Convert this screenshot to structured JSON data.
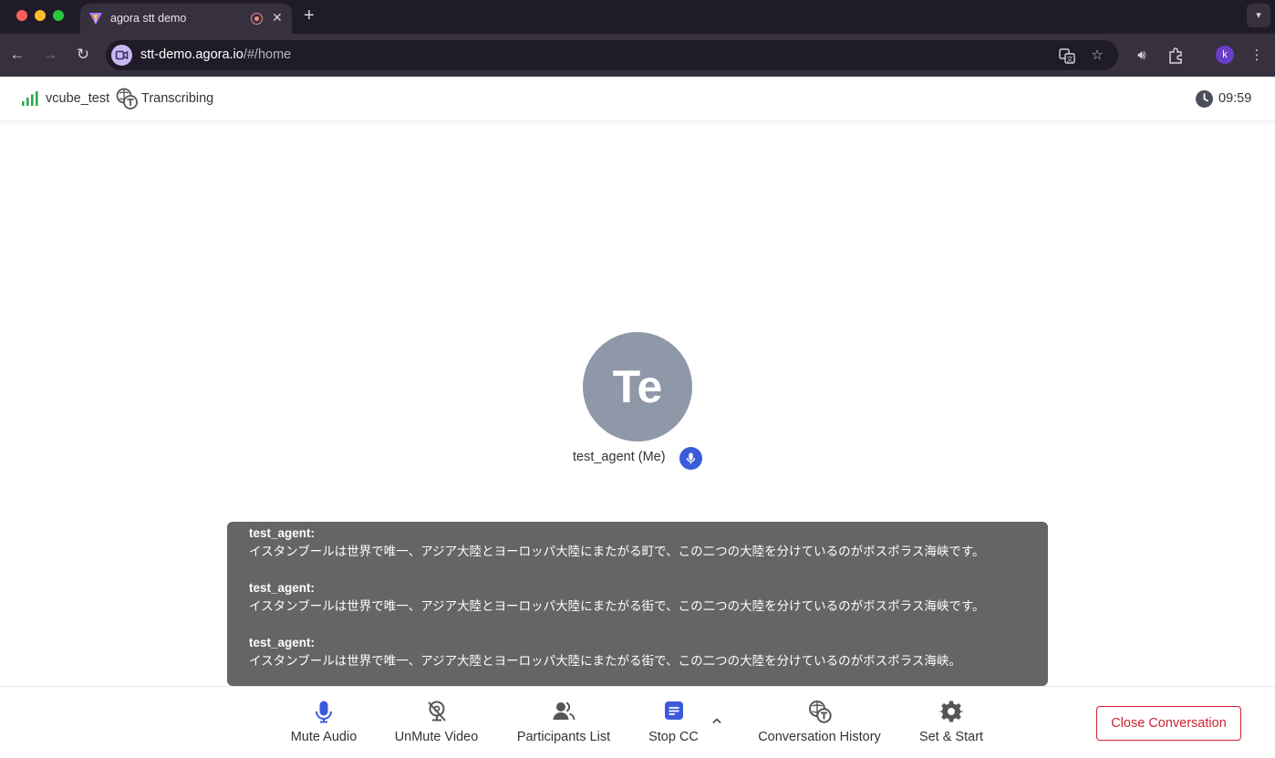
{
  "browser": {
    "tab_title": "agora stt demo",
    "url_host": "stt-demo.agora.io",
    "url_path": "/#/home",
    "profile_initial": "k"
  },
  "header": {
    "channel_name": "vcube_test",
    "status_label": "Transcribing",
    "timer": "09:59"
  },
  "participant": {
    "initials": "Te",
    "name": "test_agent (Me)"
  },
  "captions": [
    {
      "speaker": "test_agent:",
      "text": "イスタンブールは世界で唯一、アジア大陸とヨーロッパ大陸にまたがる町で、この二つの大陸を分けているのがボスポラス海峡です。"
    },
    {
      "speaker": "test_agent:",
      "text": "イスタンブールは世界で唯一、アジア大陸とヨーロッパ大陸にまたがる街で、この二つの大陸を分けているのがボスポラス海峡です。"
    },
    {
      "speaker": "test_agent:",
      "text": "イスタンブールは世界で唯一、アジア大陸とヨーロッパ大陸にまたがる街で、この二つの大陸を分けているのがボスポラス海峡。"
    }
  ],
  "controls": {
    "mute_audio": "Mute Audio",
    "unmute_video": "UnMute Video",
    "participants_list": "Participants List",
    "stop_cc": "Stop CC",
    "conversation_history": "Conversation History",
    "set_start": "Set & Start",
    "close_conversation": "Close Conversation"
  },
  "colors": {
    "accent": "#3b5bdb",
    "danger": "#cc2233",
    "signal": "#2fa84f",
    "avatar": "#8f98a8"
  }
}
